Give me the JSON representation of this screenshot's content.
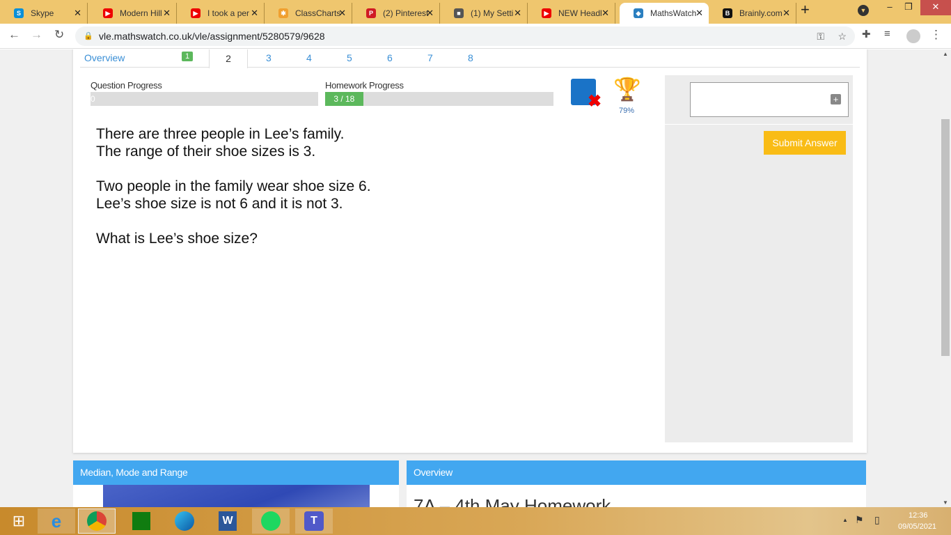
{
  "browser": {
    "tabs": [
      {
        "title": "Skype",
        "color": "#0a8fd8",
        "glyph": "S"
      },
      {
        "title": "Modern Hill",
        "color": "#e00",
        "glyph": "▶"
      },
      {
        "title": "I took a per",
        "color": "#e00",
        "glyph": "▶"
      },
      {
        "title": "ClassCharts",
        "color": "#f0a030",
        "glyph": "✱"
      },
      {
        "title": "(2) Pinterest",
        "color": "#d01a24",
        "glyph": "P"
      },
      {
        "title": "(1) My Setti",
        "color": "#555",
        "glyph": "■"
      },
      {
        "title": "NEW Headl",
        "color": "#e00",
        "glyph": "▶"
      },
      {
        "title": "MathsWatch",
        "color": "#2a7fc0",
        "glyph": "◆"
      },
      {
        "title": "Brainly.com",
        "color": "#111",
        "glyph": "B"
      }
    ],
    "url": "vle.mathswatch.co.uk/vle/assignment/5280579/9628"
  },
  "question_tabs": {
    "overview": "Overview",
    "items": [
      "1",
      "2",
      "3",
      "4",
      "5",
      "6",
      "7",
      "8"
    ],
    "active": "2",
    "completed": "1"
  },
  "progress": {
    "question_label": "Question Progress",
    "question_value": "0",
    "homework_label": "Homework Progress",
    "homework_value": "3 / 18",
    "homework_fraction": 0.1667
  },
  "trophy_percent": "79%",
  "question": {
    "lines": [
      "There are three people in Lee’s family.",
      "The range of their shoe sizes is 3.",
      "Two people in the family wear shoe size 6.",
      "Lee’s shoe size is not 6 and it is not 3.",
      "What is Lee’s shoe size?"
    ]
  },
  "answer": {
    "value": "",
    "submit_label": "Submit Answer"
  },
  "panels": {
    "left_title": "Median, Mode and Range",
    "right_title": "Overview",
    "right_heading": "7A – 4th May Homework"
  },
  "taskbar": {
    "time": "12:36",
    "date": "09/05/2021"
  }
}
